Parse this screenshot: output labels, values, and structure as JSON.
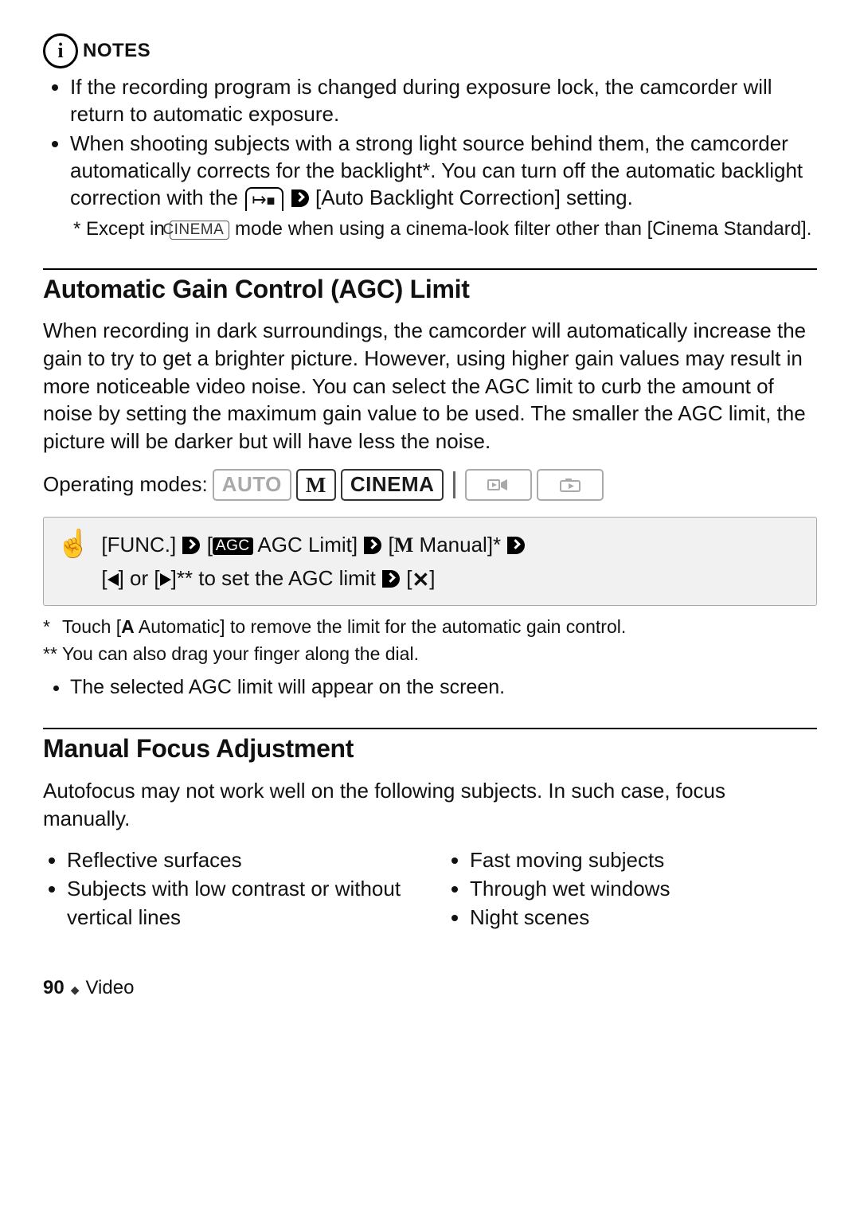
{
  "notes": {
    "header": "NOTES",
    "info_glyph": "i",
    "bullets": [
      "If the recording program is changed during exposure lock, the camcorder will return to automatic exposure.",
      "When shooting subjects with a strong light source behind them, the camcorder automatically corrects for the backlight*. You can turn off the automatic backlight correction with the ",
      " [Auto Backlight Correction] setting."
    ],
    "starnote_pre": "* Except in ",
    "starnote_pill": "CINEMA",
    "starnote_post": " mode when using a cinema-look filter other than [Cinema Standard]."
  },
  "agc": {
    "heading": "Automatic Gain Control (AGC) Limit",
    "lead": "When recording in dark surroundings, the camcorder will automatically increase the gain to try to get a brighter picture. However, using higher gain values may result in more noticeable video noise. You can select the AGC limit to curb the amount of noise by setting the maximum gain value to be used. The smaller the AGC limit, the picture will be darker but will have less the noise.",
    "modes_label": "Operating modes:",
    "modes": {
      "auto": "AUTO",
      "m": "M",
      "cinema": "CINEMA"
    },
    "proc": {
      "func": "[FUNC.]",
      "agc_chip": "AGC",
      "agc_text": " AGC Limit]",
      "m_letter": "M",
      "manual_text": " Manual]*",
      "arrows_text": "]** to set the AGC limit",
      "or": "] or ["
    },
    "fn1": "Touch [",
    "fn1_a": "A",
    "fn1_rest": " Automatic] to remove the limit for the automatic gain control.",
    "fn2": "You can also drag your finger along the dial.",
    "post_bullet": "The selected AGC limit will appear on the screen."
  },
  "focus": {
    "heading": "Manual Focus Adjustment",
    "lead": "Autofocus may not work well on the following subjects. In such case, focus manually.",
    "left": [
      "Reflective surfaces",
      "Subjects with low contrast or without vertical lines"
    ],
    "right": [
      "Fast moving subjects",
      "Through wet windows",
      "Night scenes"
    ]
  },
  "footer": {
    "page": "90",
    "section": "Video"
  }
}
